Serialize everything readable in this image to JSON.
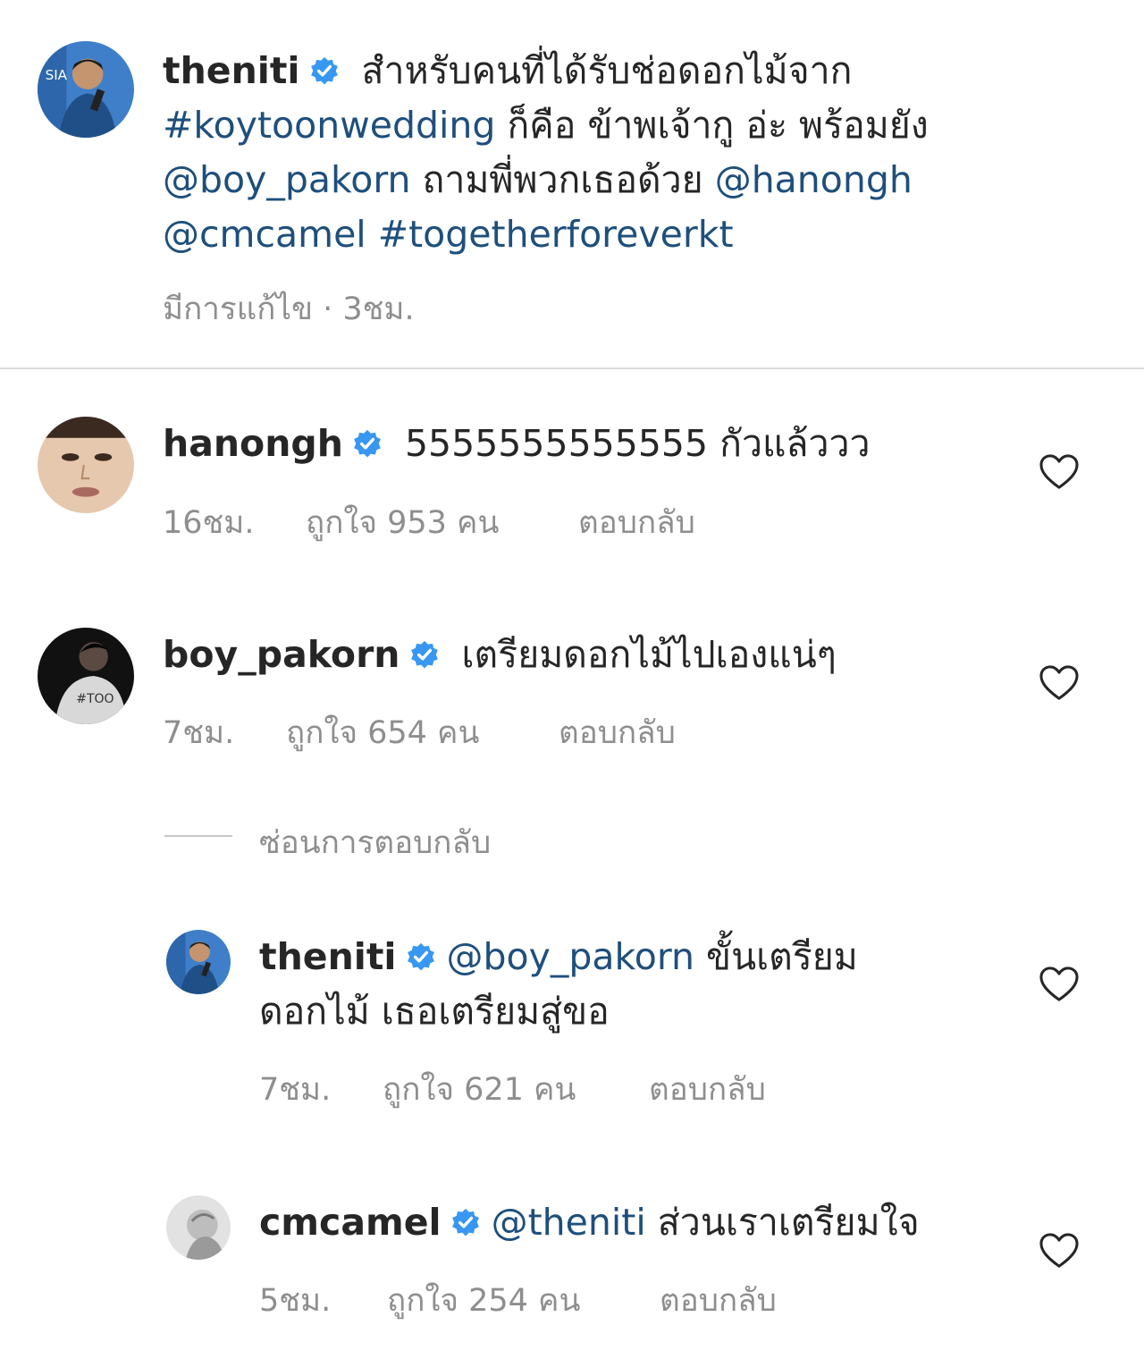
{
  "colors": {
    "link": "#1e4f7c",
    "verified": "#3897f0",
    "meta": "#8e8e8e",
    "divider": "#dbdbdb"
  },
  "icons": {
    "verified": "verified-badge-icon",
    "like": "heart-outline-icon"
  },
  "caption": {
    "username": "theniti",
    "text_1": " สำหรับคนที่ได้รับช่อดอกไม้จาก",
    "hashtag_1": "#koytoonwedding",
    "text_2": " ก็คือ ข้าพเจ้ากู อ่ะ พร้อมยัง",
    "mention_1": "@boy_pakorn",
    "text_3": " ถามพี่พวกเธอด้วย ",
    "mention_2": "@hanongh",
    "mention_3": "@cmcamel",
    "text_4": " ",
    "hashtag_2": "#togetherforeverkt",
    "edited": "มีการแก้ไข",
    "separator": " · ",
    "time": "3ชม."
  },
  "comments": [
    {
      "username": "hanongh",
      "text": " 5555555555555 กัวแล้ววว",
      "time": "16ชม.",
      "likes": "ถูกใจ 953 คน",
      "reply": "ตอบกลับ"
    },
    {
      "username": "boy_pakorn",
      "text": " เตรียมดอกไม้ไปเองแน่ๆ",
      "time": "7ชม.",
      "likes": "ถูกใจ 654 คน",
      "reply": "ตอบกลับ"
    }
  ],
  "hide_replies": "ซ่อนการตอบกลับ",
  "replies": [
    {
      "username": "theniti",
      "mention": "@boy_pakorn",
      "text": " ขั้นเตรียมดอกไม้ เธอเตรียมสู่ขอ",
      "time": "7ชม.",
      "likes": "ถูกใจ 621 คน",
      "reply": "ตอบกลับ"
    },
    {
      "username": "cmcamel",
      "mention": "@theniti",
      "text": " ส่วนเราเตรียมใจ",
      "time": "5ชม.",
      "likes": "ถูกใจ 254 คน",
      "reply": "ตอบกลับ"
    }
  ]
}
